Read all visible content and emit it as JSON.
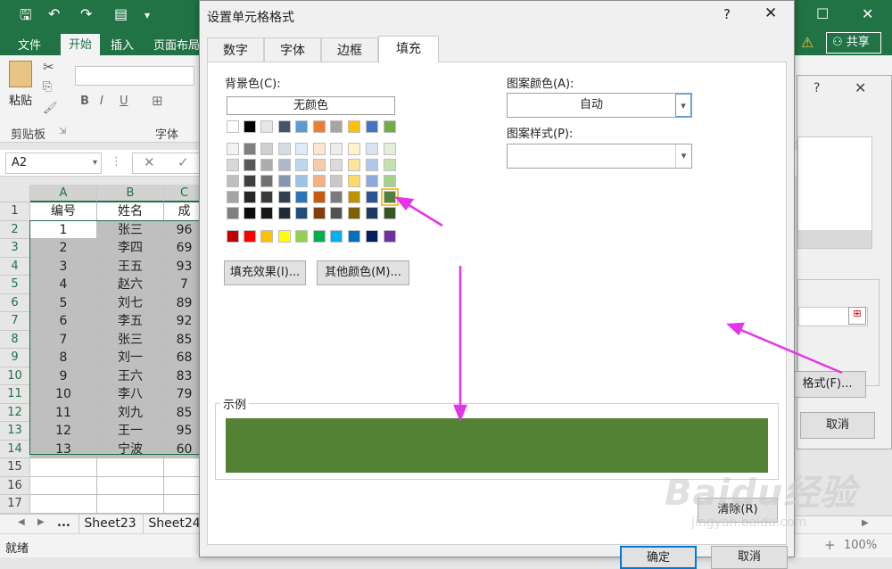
{
  "excel": {
    "ribbon_tabs": [
      "文件",
      "开始",
      "插入",
      "页面布局"
    ],
    "share_label": "共享",
    "paste_label": "粘贴",
    "clipboard_group": "剪贴板",
    "font_group": "字体",
    "name_box": "A2",
    "columns": [
      "A",
      "B",
      "C"
    ],
    "rows": [
      {
        "n": "1",
        "a": "编号",
        "b": "姓名",
        "c": "成"
      },
      {
        "n": "2",
        "a": "1",
        "b": "张三",
        "c": "96"
      },
      {
        "n": "3",
        "a": "2",
        "b": "李四",
        "c": "69"
      },
      {
        "n": "4",
        "a": "3",
        "b": "王五",
        "c": "93"
      },
      {
        "n": "5",
        "a": "4",
        "b": "赵六",
        "c": "7"
      },
      {
        "n": "6",
        "a": "5",
        "b": "刘七",
        "c": "89"
      },
      {
        "n": "7",
        "a": "6",
        "b": "李五",
        "c": "92"
      },
      {
        "n": "8",
        "a": "7",
        "b": "张三",
        "c": "85"
      },
      {
        "n": "9",
        "a": "8",
        "b": "刘一",
        "c": "68"
      },
      {
        "n": "10",
        "a": "9",
        "b": "王六",
        "c": "83"
      },
      {
        "n": "11",
        "a": "10",
        "b": "李八",
        "c": "79"
      },
      {
        "n": "12",
        "a": "11",
        "b": "刘九",
        "c": "85"
      },
      {
        "n": "13",
        "a": "12",
        "b": "王一",
        "c": "95"
      },
      {
        "n": "14",
        "a": "13",
        "b": "宁波",
        "c": "60"
      },
      {
        "n": "15",
        "a": "",
        "b": "",
        "c": ""
      },
      {
        "n": "16",
        "a": "",
        "b": "",
        "c": ""
      },
      {
        "n": "17",
        "a": "",
        "b": "",
        "c": ""
      }
    ],
    "sheet_tabs": [
      "...",
      "Sheet23",
      "Sheet24"
    ],
    "status": "就绪",
    "zoom": "100%"
  },
  "bg_dialog": {
    "format_button": "格式(F)...",
    "cancel_button": "取消"
  },
  "dialog": {
    "title": "设置单元格格式",
    "help": "?",
    "tabs": [
      "数字",
      "字体",
      "边框",
      "填充"
    ],
    "active_tab": "填充",
    "background_color_label": "背景色(C):",
    "no_color": "无颜色",
    "pattern_color_label": "图案颜色(A):",
    "pattern_color_value": "自动",
    "pattern_style_label": "图案样式(P):",
    "pattern_style_value": "",
    "fill_effects_button": "填充效果(I)...",
    "more_colors_button": "其他颜色(M)...",
    "sample_label": "示例",
    "clear_button": "清除(R)",
    "ok_button": "确定",
    "cancel_button": "取消",
    "sample_color": "#548235",
    "theme_colors": [
      [
        "#ffffff",
        "#000000",
        "#e7e6e6",
        "#44546a",
        "#5b9bd5",
        "#ed7d31",
        "#a5a5a5",
        "#ffc000",
        "#4472c4",
        "#70ad47"
      ],
      [
        "#f2f2f2",
        "#7f7f7f",
        "#d0cece",
        "#d6dce4",
        "#deebf6",
        "#fbe5d5",
        "#ededed",
        "#fff2cc",
        "#dae3f3",
        "#e2efd9"
      ],
      [
        "#d8d8d8",
        "#595959",
        "#aeabab",
        "#adb9ca",
        "#bdd7ee",
        "#f7cbac",
        "#dbdbdb",
        "#fee599",
        "#b4c6e7",
        "#c5e0b3"
      ],
      [
        "#bfbfbf",
        "#3f3f3f",
        "#757070",
        "#8496b0",
        "#9cc3e5",
        "#f4b183",
        "#c9c9c9",
        "#ffd965",
        "#8eaadb",
        "#a8d08d"
      ],
      [
        "#a5a5a5",
        "#262626",
        "#3a3838",
        "#323f4f",
        "#2e75b5",
        "#c55a11",
        "#7b7b7b",
        "#bf9000",
        "#2f5496",
        "#538135"
      ],
      [
        "#7f7f7f",
        "#0c0c0c",
        "#171616",
        "#222a35",
        "#1e4e79",
        "#833c0b",
        "#525252",
        "#7f6000",
        "#1f3864",
        "#375623"
      ]
    ],
    "standard_colors": [
      "#c00000",
      "#ff0000",
      "#ffc000",
      "#ffff00",
      "#92d050",
      "#00b050",
      "#00b0f0",
      "#0070c0",
      "#002060",
      "#7030a0"
    ]
  },
  "watermark": "Baidu经验",
  "watermark_url": "jingyan.baidu.com"
}
